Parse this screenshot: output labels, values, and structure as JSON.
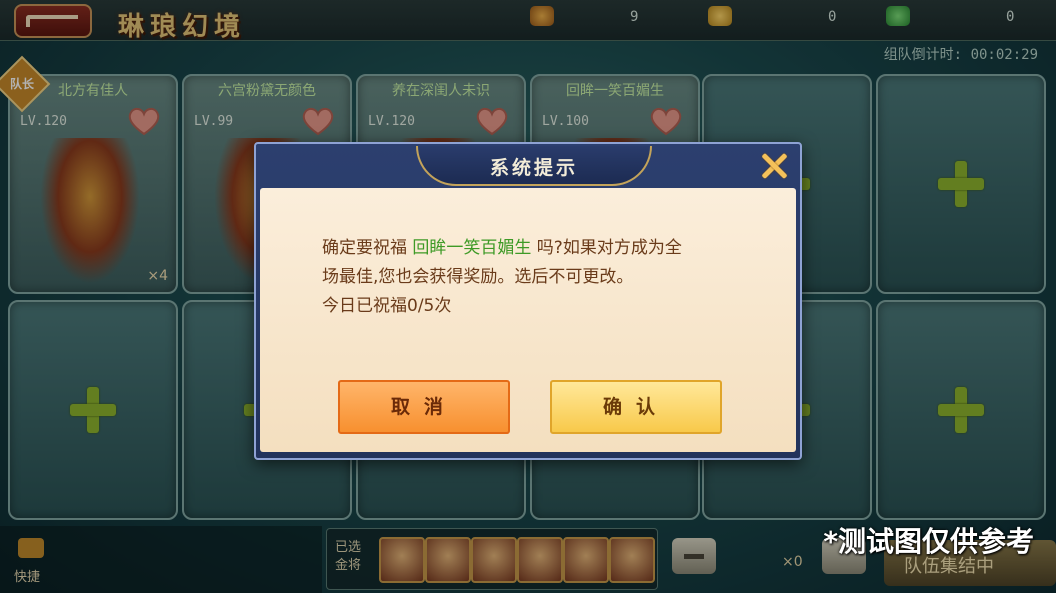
{
  "header": {
    "title": "琳琅幻境",
    "resources": [
      {
        "icon": "gold-pouch-icon",
        "value": "9"
      },
      {
        "icon": "ingot-icon",
        "value": "0"
      },
      {
        "icon": "green-token-icon",
        "value": "0"
      }
    ],
    "countdown_label": "组队倒计时:",
    "countdown_value": "00:02:29"
  },
  "team": {
    "captain_badge": "队长",
    "members": [
      {
        "name": "北方有佳人",
        "level": "LV.120",
        "extra": "×4"
      },
      {
        "name": "六宫粉黛无颜色",
        "level": "LV.99"
      },
      {
        "name": "养在深闺人未识",
        "level": "LV.120"
      },
      {
        "name": "回眸一笑百媚生",
        "level": "LV.100"
      }
    ]
  },
  "bottom": {
    "chat_label": "快捷",
    "selected_label": "已选金将",
    "count": "×0",
    "matching_label": "队伍集结中"
  },
  "dialog": {
    "title": "系统提示",
    "line1_prefix": "确定要祝福 ",
    "highlight_name": "回眸一笑百媚生",
    "line1_suffix": " 吗?如果对方成为全",
    "line2": "场最佳,您也会获得奖励。选后不可更改。",
    "line3": "今日已祝福0/5次",
    "cancel_label": "取消",
    "confirm_label": "确认"
  },
  "watermark": "*测试图仅供参考"
}
